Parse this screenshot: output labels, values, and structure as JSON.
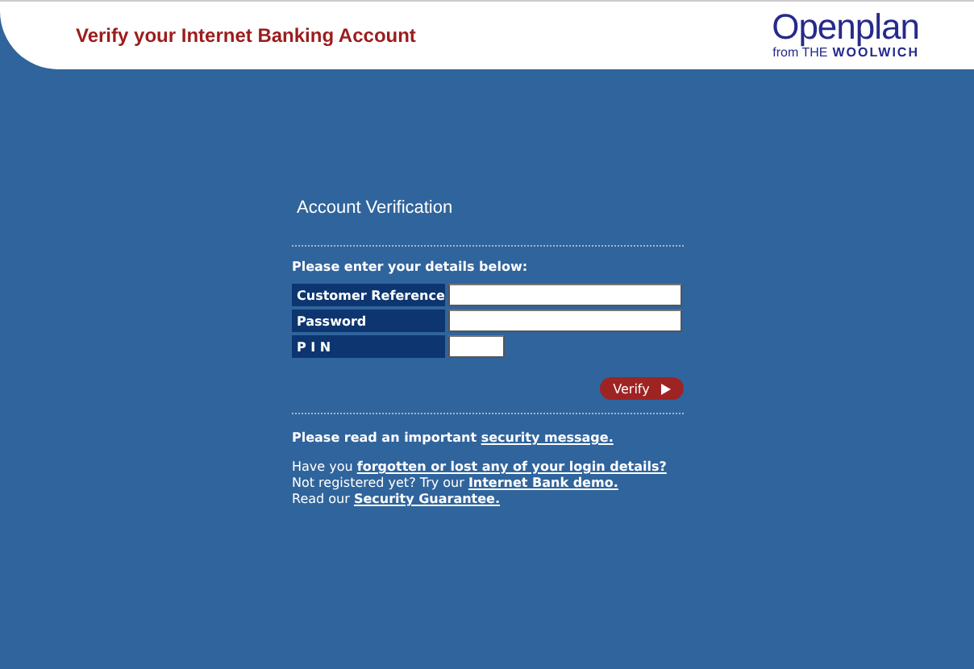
{
  "header": {
    "title": "Verify your Internet Banking Account",
    "logo": {
      "name": "Openplan",
      "from": "from THE",
      "brand": "WOOLWICH"
    }
  },
  "form": {
    "title": "Account Verification",
    "intro": "Please enter your details below:",
    "fields": [
      {
        "label": "Customer Reference",
        "kind": "wide"
      },
      {
        "label": "Password",
        "kind": "wide"
      },
      {
        "label": "P I N",
        "kind": "short"
      }
    ],
    "submit": "Verify"
  },
  "notice": {
    "text": "Please read an important",
    "link": "security message."
  },
  "help": [
    {
      "text": "Have you",
      "link": "forgotten or lost any of your login details?"
    },
    {
      "text": "Not registered yet? Try our",
      "link": "Internet Bank demo."
    },
    {
      "text": "Read our",
      "link": "Security Guarantee."
    }
  ]
}
